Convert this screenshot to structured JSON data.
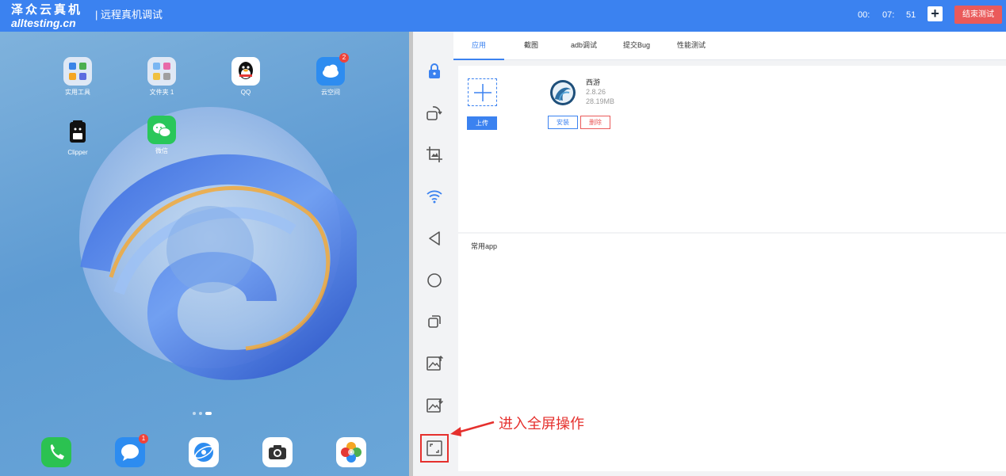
{
  "header": {
    "brand_cn": "泽众云真机",
    "brand_en": "alltesting.cn",
    "title": "| 远程真机调试",
    "timer": {
      "hours": "00:",
      "minutes": "07:",
      "seconds": "51"
    },
    "plus_label": "+",
    "end_label": "结束测试"
  },
  "device": {
    "apps": [
      {
        "label": "实用工具",
        "icon": "utilities-folder-icon"
      },
      {
        "label": "文件夹 1",
        "icon": "folder-icon"
      },
      {
        "label": "QQ",
        "icon": "qq-icon"
      },
      {
        "label": "云空间",
        "icon": "cloud-icon",
        "badge": "2"
      },
      {
        "label": "Clipper",
        "icon": "android-icon"
      },
      {
        "label": "微信",
        "icon": "wechat-icon"
      }
    ],
    "dock": [
      {
        "icon": "phone-icon"
      },
      {
        "icon": "messages-icon",
        "badge": "1"
      },
      {
        "icon": "browser-icon"
      },
      {
        "icon": "camera-icon"
      },
      {
        "icon": "gallery-icon"
      }
    ]
  },
  "tabs": [
    "应用",
    "截图",
    "adb调试",
    "提交Bug",
    "性能测试"
  ],
  "active_tab": "应用",
  "toolbar": [
    "lock-icon",
    "rotate-icon",
    "crop-icon",
    "wifi-icon",
    "back-icon",
    "home-icon",
    "recent-apps-icon",
    "image-upload-icon",
    "image-download-icon",
    "fullscreen-icon"
  ],
  "upload": {
    "button_label": "上传"
  },
  "installed_app": {
    "name": "西游",
    "version": "2.8.26",
    "size": "28.19MB",
    "install_label": "安装",
    "delete_label": "删除"
  },
  "common_apps_label": "常用app",
  "annotation": "进入全屏操作",
  "colors": {
    "accent": "#3b82f0",
    "danger": "#ea5a5a",
    "annotation": "#e5302d"
  }
}
